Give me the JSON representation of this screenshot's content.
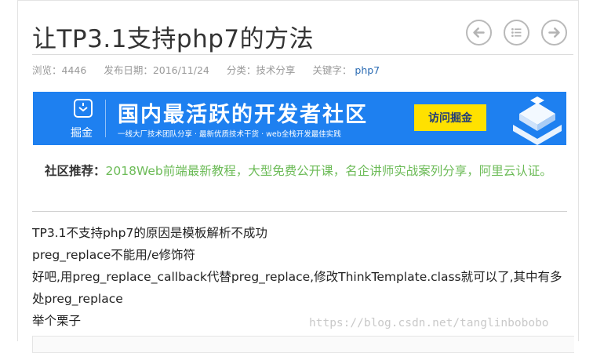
{
  "article": {
    "title": "让TP3.1支持php7的方法",
    "meta": {
      "views_label": "浏览：",
      "views": "4446",
      "date_label": "发布日期：",
      "date": "2016/11/24",
      "category_label": "分类：",
      "category": "技术分享",
      "keywords_label": "关键字：",
      "keyword": "php7"
    }
  },
  "nav": {
    "prev_icon": "arrow-left-icon",
    "list_icon": "list-icon",
    "next_icon": "arrow-right-icon"
  },
  "banner": {
    "logo_text": "掘金",
    "headline": "国内最活跃的开发者社区",
    "subline": "一线大厂技术团队分享 · 最新优质技术干货 · web全栈开发最佳实践",
    "button_label": "访问掘金",
    "colors": {
      "background": "#1e80f0",
      "button": "#ffe100"
    }
  },
  "recommend": {
    "label": "社区推荐：",
    "link_text": "2018Web前端最新教程，大型免费公开课，名企讲师实战案列分享，阿里云认证。"
  },
  "body": {
    "lines": [
      "TP3.1不支持php7的原因是模板解析不成功",
      "preg_replace不能用/e修饰符",
      "好吧,用preg_replace_callback代替preg_replace,修改ThinkTemplate.class就可以了,其中有多处preg_replace",
      "举个栗子"
    ]
  },
  "watermark": "https://blog.csdn.net/tanglinbobobo"
}
